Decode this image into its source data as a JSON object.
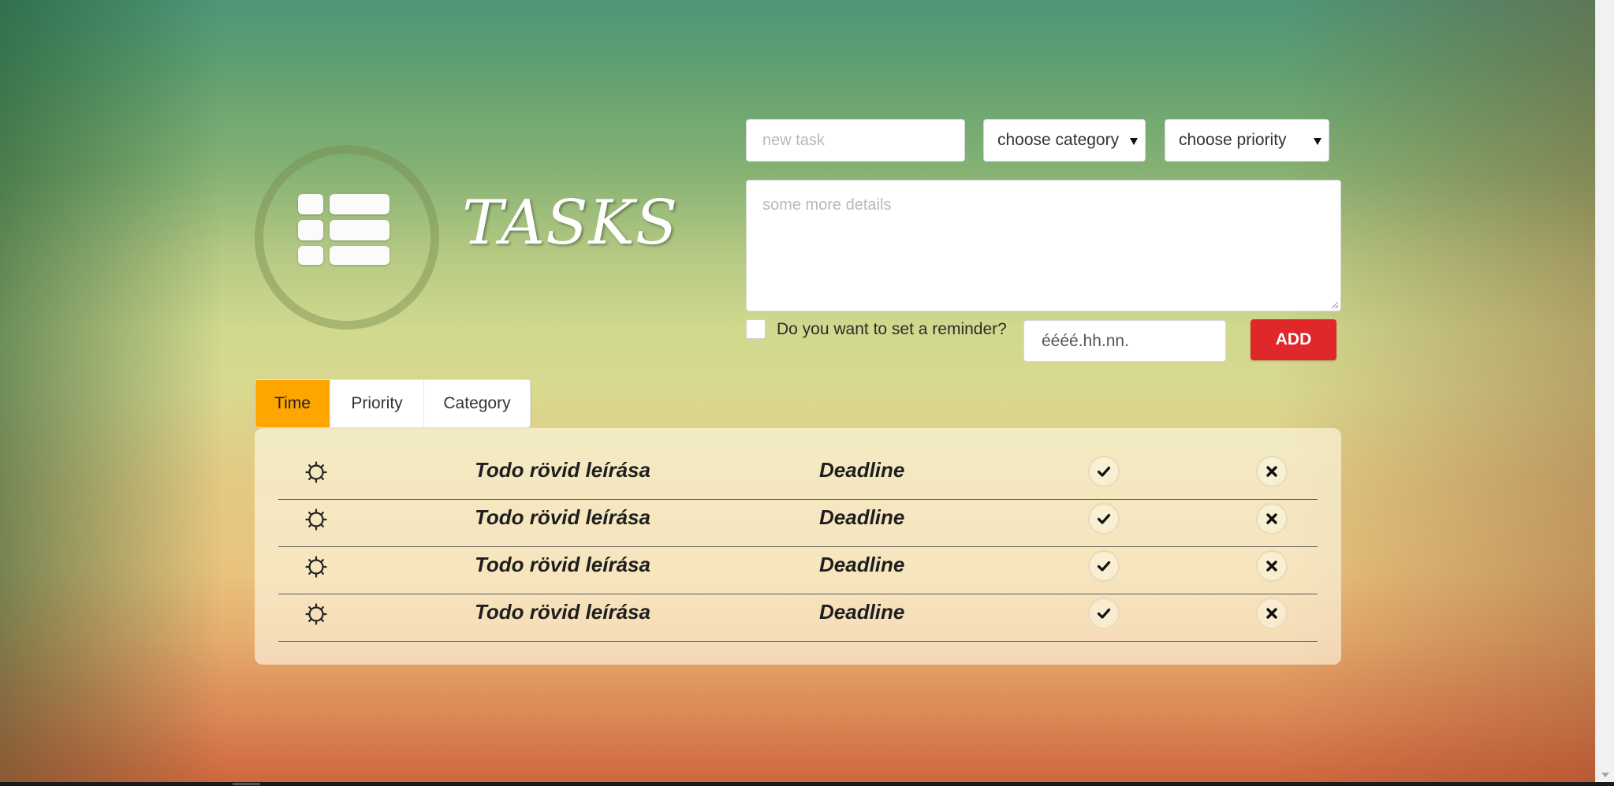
{
  "app": {
    "title": "TASKS"
  },
  "form": {
    "new_task_placeholder": "new task",
    "category_select": {
      "selected": "choose category"
    },
    "priority_select": {
      "selected": "choose priority"
    },
    "details_placeholder": "some more details",
    "reminder_label": "Do you want to set a reminder?",
    "reminder_checked": false,
    "date_value": "éééé.hh.nn.",
    "add_label": "ADD"
  },
  "tabs": [
    {
      "label": "Time",
      "active": true
    },
    {
      "label": "Priority",
      "active": false
    },
    {
      "label": "Category",
      "active": false
    }
  ],
  "tasks": [
    {
      "description": "Todo rövid leírása",
      "deadline": "Deadline"
    },
    {
      "description": "Todo rövid leírása",
      "deadline": "Deadline"
    },
    {
      "description": "Todo rövid leírása",
      "deadline": "Deadline"
    },
    {
      "description": "Todo rövid leírása",
      "deadline": "Deadline"
    }
  ],
  "icons": {
    "logo": "list-icon",
    "task_status": "sun-icon",
    "done": "check-icon",
    "delete": "close-icon"
  },
  "colors": {
    "active_tab": "#ffa500",
    "add_button": "#e0272a",
    "title_text": "#ffffff"
  }
}
